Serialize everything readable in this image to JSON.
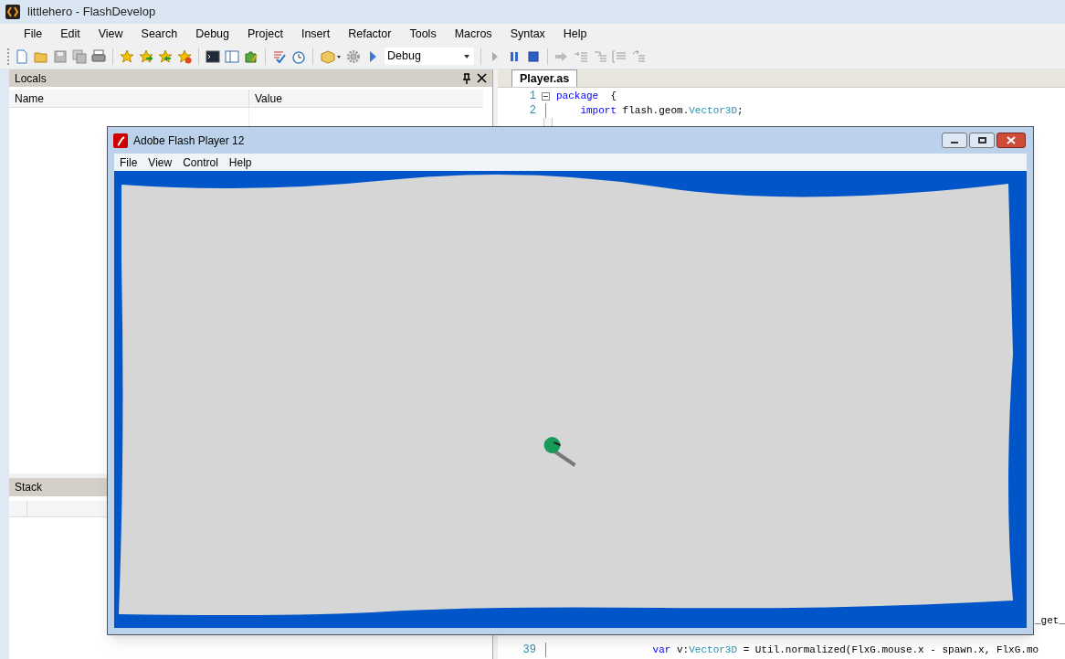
{
  "window": {
    "title": "littlehero - FlashDevelop"
  },
  "menu": [
    "File",
    "Edit",
    "View",
    "Search",
    "Debug",
    "Project",
    "Insert",
    "Refactor",
    "Tools",
    "Macros",
    "Syntax",
    "Help"
  ],
  "toolbar": {
    "config_dropdown": "Debug"
  },
  "locals_panel": {
    "title": "Locals",
    "columns": [
      "Name",
      "Value"
    ]
  },
  "stack_panel": {
    "title": "Stack"
  },
  "editor": {
    "tabs": [
      {
        "label": "Player.as",
        "selected": true
      }
    ],
    "lines": [
      {
        "number": "1",
        "fold": true,
        "segments": [
          {
            "kind": "keyword",
            "text": "package"
          },
          {
            "kind": "plain",
            "text": "  {"
          }
        ]
      },
      {
        "number": "2",
        "fold": false,
        "segments": [
          {
            "kind": "keyword",
            "text": "    import"
          },
          {
            "kind": "plain",
            "text": " flash.geom."
          },
          {
            "kind": "type",
            "text": "Vector3D"
          },
          {
            "kind": "plain",
            "text": ";"
          }
        ]
      }
    ],
    "bottom_lines": [
      {
        "fold": false,
        "segments": [
          {
            "kind": "tail",
            "text": "_get_"
          }
        ]
      },
      {
        "number": "39",
        "fold": false,
        "segments": [
          {
            "kind": "keyword",
            "text": "                var"
          },
          {
            "kind": "plain",
            "text": " v:"
          },
          {
            "kind": "type",
            "text": "Vector3D"
          },
          {
            "kind": "plain",
            "text": " = Util.normalized(FlxG.mouse.x - spawn.x, FlxG.mo"
          }
        ]
      }
    ]
  },
  "player_window": {
    "title": "Adobe Flash Player 12",
    "menu": [
      "File",
      "View",
      "Control",
      "Help"
    ]
  }
}
